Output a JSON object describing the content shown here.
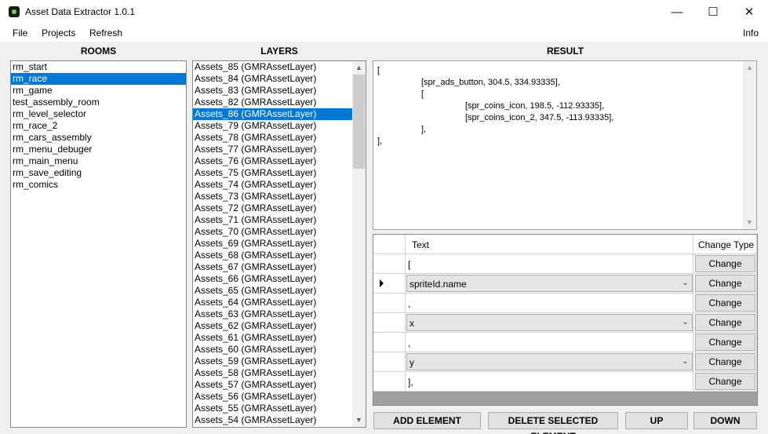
{
  "window": {
    "title": "Asset Data Extractor 1.0.1",
    "minimize_glyph": "—",
    "maximize_glyph": "☐",
    "close_glyph": "✕"
  },
  "menu": {
    "file": "File",
    "projects": "Projects",
    "refresh": "Refresh",
    "info": "Info"
  },
  "headers": {
    "rooms": "ROOMS",
    "layers": "LAYERS",
    "result": "RESULT"
  },
  "rooms": [
    "rm_start",
    "rm_race",
    "rm_game",
    "test_assembly_room",
    "rm_level_selector",
    "rm_race_2",
    "rm_cars_assembly",
    "rm_menu_debuger",
    "rm_main_menu",
    "rm_save_editing",
    "rm_comics"
  ],
  "rooms_selected": 1,
  "layers": [
    "Assets_85 (GMRAssetLayer)",
    "Assets_84 (GMRAssetLayer)",
    "Assets_83 (GMRAssetLayer)",
    "Assets_82 (GMRAssetLayer)",
    "Assets_86 (GMRAssetLayer)",
    "Assets_79 (GMRAssetLayer)",
    "Assets_78 (GMRAssetLayer)",
    "Assets_77 (GMRAssetLayer)",
    "Assets_76 (GMRAssetLayer)",
    "Assets_75 (GMRAssetLayer)",
    "Assets_74 (GMRAssetLayer)",
    "Assets_73 (GMRAssetLayer)",
    "Assets_72 (GMRAssetLayer)",
    "Assets_71 (GMRAssetLayer)",
    "Assets_70 (GMRAssetLayer)",
    "Assets_69 (GMRAssetLayer)",
    "Assets_68 (GMRAssetLayer)",
    "Assets_67 (GMRAssetLayer)",
    "Assets_66 (GMRAssetLayer)",
    "Assets_65 (GMRAssetLayer)",
    "Assets_64 (GMRAssetLayer)",
    "Assets_63 (GMRAssetLayer)",
    "Assets_62 (GMRAssetLayer)",
    "Assets_61 (GMRAssetLayer)",
    "Assets_60 (GMRAssetLayer)",
    "Assets_59 (GMRAssetLayer)",
    "Assets_58 (GMRAssetLayer)",
    "Assets_57 (GMRAssetLayer)",
    "Assets_56 (GMRAssetLayer)",
    "Assets_55 (GMRAssetLayer)",
    "Assets_54 (GMRAssetLayer)"
  ],
  "layers_selected": 4,
  "layers_scroll": {
    "up_glyph": "▲",
    "down_glyph": "▼"
  },
  "result": {
    "lines": [
      {
        "text": "[",
        "indent": 0
      },
      {
        "text": "[spr_ads_button, 304.5, 334.93335],",
        "indent": 1
      },
      {
        "text": "[",
        "indent": 1
      },
      {
        "text": "[spr_coins_icon, 198.5, -112.93335],",
        "indent": 2
      },
      {
        "text": "[spr_coins_icon_2, 347.5, -113.93335],",
        "indent": 2
      },
      {
        "text": "],",
        "indent": 1
      },
      {
        "text": "],",
        "indent": 0
      }
    ]
  },
  "grid": {
    "columns": {
      "text": "Text",
      "change_type": "Change Type"
    },
    "rows": [
      {
        "kind": "text",
        "value": "[",
        "button": "Change"
      },
      {
        "kind": "combo",
        "value": "spriteId.name",
        "button": "Change",
        "current": true
      },
      {
        "kind": "text",
        "value": ",",
        "button": "Change"
      },
      {
        "kind": "combo",
        "value": "x",
        "button": "Change"
      },
      {
        "kind": "text",
        "value": ",",
        "button": "Change"
      },
      {
        "kind": "combo",
        "value": "y",
        "button": "Change"
      },
      {
        "kind": "text",
        "value": "],",
        "button": "Change"
      }
    ],
    "combo_arrow": "⌄"
  },
  "buttons": {
    "add": "ADD ELEMENT",
    "delete": "DELETE SELECTED ELEMENT",
    "up": "UP",
    "down": "DOWN"
  }
}
